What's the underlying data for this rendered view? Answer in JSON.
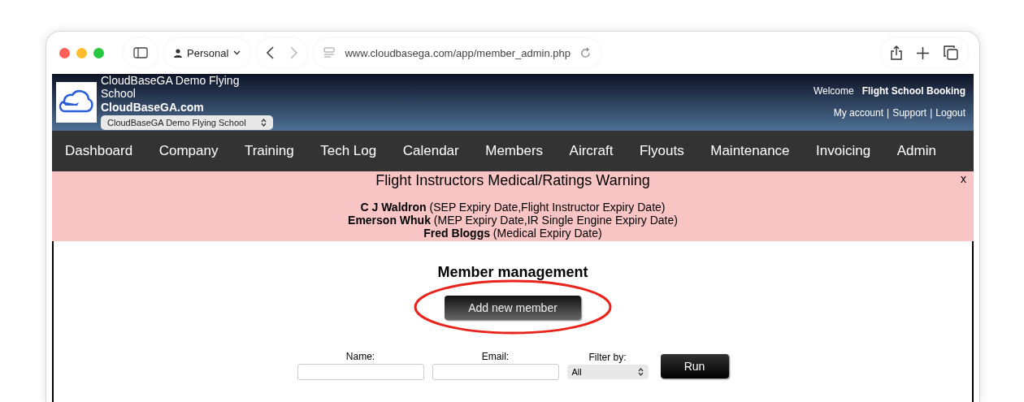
{
  "browser": {
    "profile": "Personal",
    "url": "www.cloudbasega.com/app/member_admin.php"
  },
  "header": {
    "school_name": "CloudBaseGA Demo Flying School",
    "site": "CloudBaseGA.com",
    "school_select": "CloudBaseGA Demo Flying School",
    "welcome": "Welcome",
    "user": "Flight School Booking",
    "links": [
      "My account",
      "Support",
      "Logout"
    ],
    "separator": "|"
  },
  "nav": [
    "Dashboard",
    "Company",
    "Training",
    "Tech Log",
    "Calendar",
    "Members",
    "Aircraft",
    "Flyouts",
    "Maintenance",
    "Invoicing",
    "Admin"
  ],
  "warning": {
    "title": "Flight Instructors Medical/Ratings Warning",
    "close": "x",
    "entries": [
      {
        "name": "C J Waldron",
        "detail": "(SEP Expiry Date,Flight Instructor Expiry Date)"
      },
      {
        "name": "Emerson Whuk",
        "detail": "(MEP Expiry Date,IR Single Engine Expiry Date)"
      },
      {
        "name": "Fred Bloggs",
        "detail": "(Medical Expiry Date)"
      }
    ]
  },
  "main": {
    "title": "Member management",
    "add_button": "Add new member",
    "filters": {
      "name_label": "Name:",
      "email_label": "Email:",
      "filter_label": "Filter by:",
      "filter_value": "All",
      "run_button": "Run"
    }
  }
}
